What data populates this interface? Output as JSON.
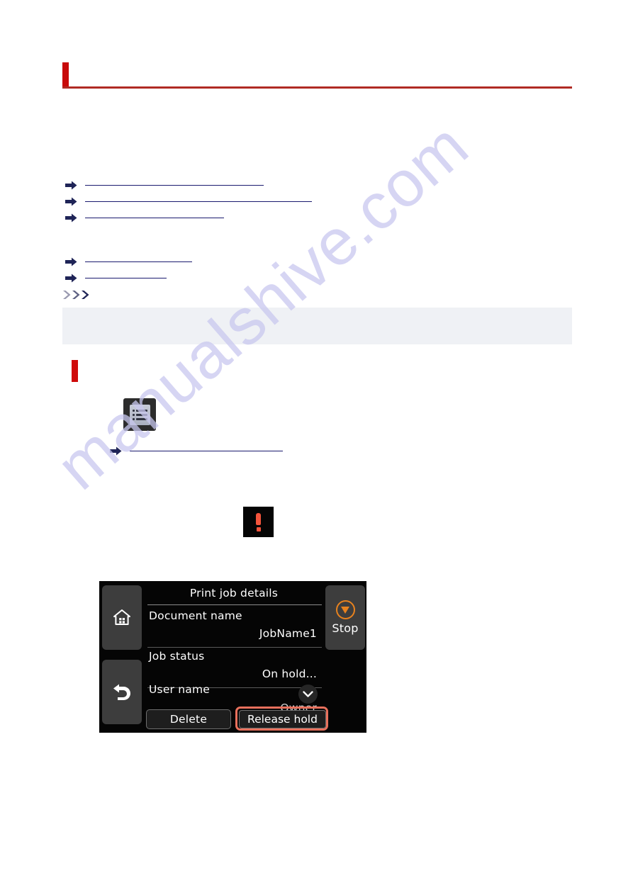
{
  "page": {
    "heading": "",
    "section_heading": "",
    "link_groups": [
      {
        "items": [
          {
            "label": ""
          },
          {
            "label": ""
          },
          {
            "label": ""
          }
        ]
      },
      {
        "items": [
          {
            "label": ""
          },
          {
            "label": ""
          }
        ]
      }
    ],
    "note": {
      "marker_label": "",
      "body": ""
    },
    "step_link": {
      "label": ""
    },
    "figures": {
      "menu_button": {
        "icon": "list-menu-icon"
      },
      "alert_icon": {
        "icon": "exclamation-icon"
      }
    }
  },
  "printer_screen": {
    "title": "Print job details",
    "keys": {
      "home": "home-icon",
      "back": "back-arrow-icon",
      "stop_label": "Stop",
      "stop_icon": "stop-circle-icon"
    },
    "fields": [
      {
        "label": "Document name",
        "value": "JobName1"
      },
      {
        "label": "Job status",
        "value": "On hold..."
      },
      {
        "label": "User name",
        "value": "Owner"
      }
    ],
    "scroll_icon": "chevron-down-icon",
    "buttons": {
      "delete": "Delete",
      "release_hold": "Release hold"
    },
    "highlight_color": "#e8705c",
    "accent_color": "#e8821e"
  },
  "watermark": {
    "text": "manualshive.com",
    "color": "#c9c8ef"
  },
  "theme": {
    "heading_accent": "#c80a0a",
    "rule_color": "#b02b24",
    "link_color": "#1a1a6e",
    "note_background": "#eff1f5"
  }
}
